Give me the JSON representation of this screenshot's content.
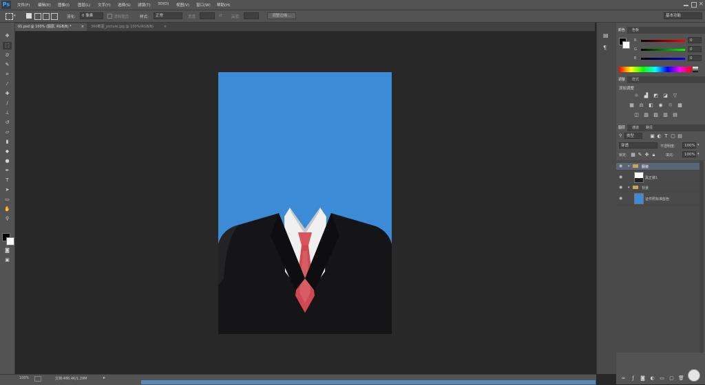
{
  "app": {
    "logo": "Ps"
  },
  "menu": {
    "items": [
      "文件(F)",
      "编辑(E)",
      "图像(I)",
      "图层(L)",
      "文字(Y)",
      "选择(S)",
      "滤镜(T)",
      "3D(D)",
      "视图(V)",
      "窗口(W)",
      "帮助(H)"
    ]
  },
  "options": {
    "feather_label": "羽化:",
    "feather_value": "0 像素",
    "antialias_label": "消除锯齿",
    "style_label": "样式:",
    "style_value": "正常",
    "width_label": "宽度:",
    "height_label": "高度:",
    "refine_edge": "调整边缘...",
    "workspace": "基本功能"
  },
  "tabs": [
    {
      "label": "01.psd @ 100% (图层, RGB/8) *",
      "close": "×"
    },
    {
      "label": "360截图_picture.jpg @ 100%(RGB/8)",
      "close": "×"
    }
  ],
  "color_panel": {
    "tabs": [
      "颜色",
      "色板"
    ],
    "channels": [
      {
        "name": "R",
        "value": "0"
      },
      {
        "name": "G",
        "value": "0"
      },
      {
        "name": "B",
        "value": "0"
      }
    ]
  },
  "adjustments_panel": {
    "tabs": [
      "调整",
      "样式"
    ],
    "add_label": "添加调整"
  },
  "layers_panel": {
    "tabs": [
      "图层",
      "通道",
      "路径"
    ],
    "kind_label": "类型",
    "blend_mode": "穿透",
    "opacity_label": "不透明度:",
    "opacity_value": "100%",
    "lock_label": "锁定:",
    "fill_label": "填充:",
    "fill_value": "100%",
    "layers": [
      {
        "name": "服装",
        "type": "group",
        "selected": true
      },
      {
        "name": "黑正装1",
        "type": "layer"
      },
      {
        "name": "背景",
        "type": "group"
      },
      {
        "name": "证件照标准蓝色",
        "type": "layer"
      }
    ]
  },
  "status": {
    "zoom": "100%",
    "doc_info": "文档:486.4K/1.29M"
  },
  "colors": {
    "canvas_blue": "#3b8bd6",
    "suit": "#141416",
    "tie": "#d24c52",
    "shirt": "#f2f2f2"
  }
}
